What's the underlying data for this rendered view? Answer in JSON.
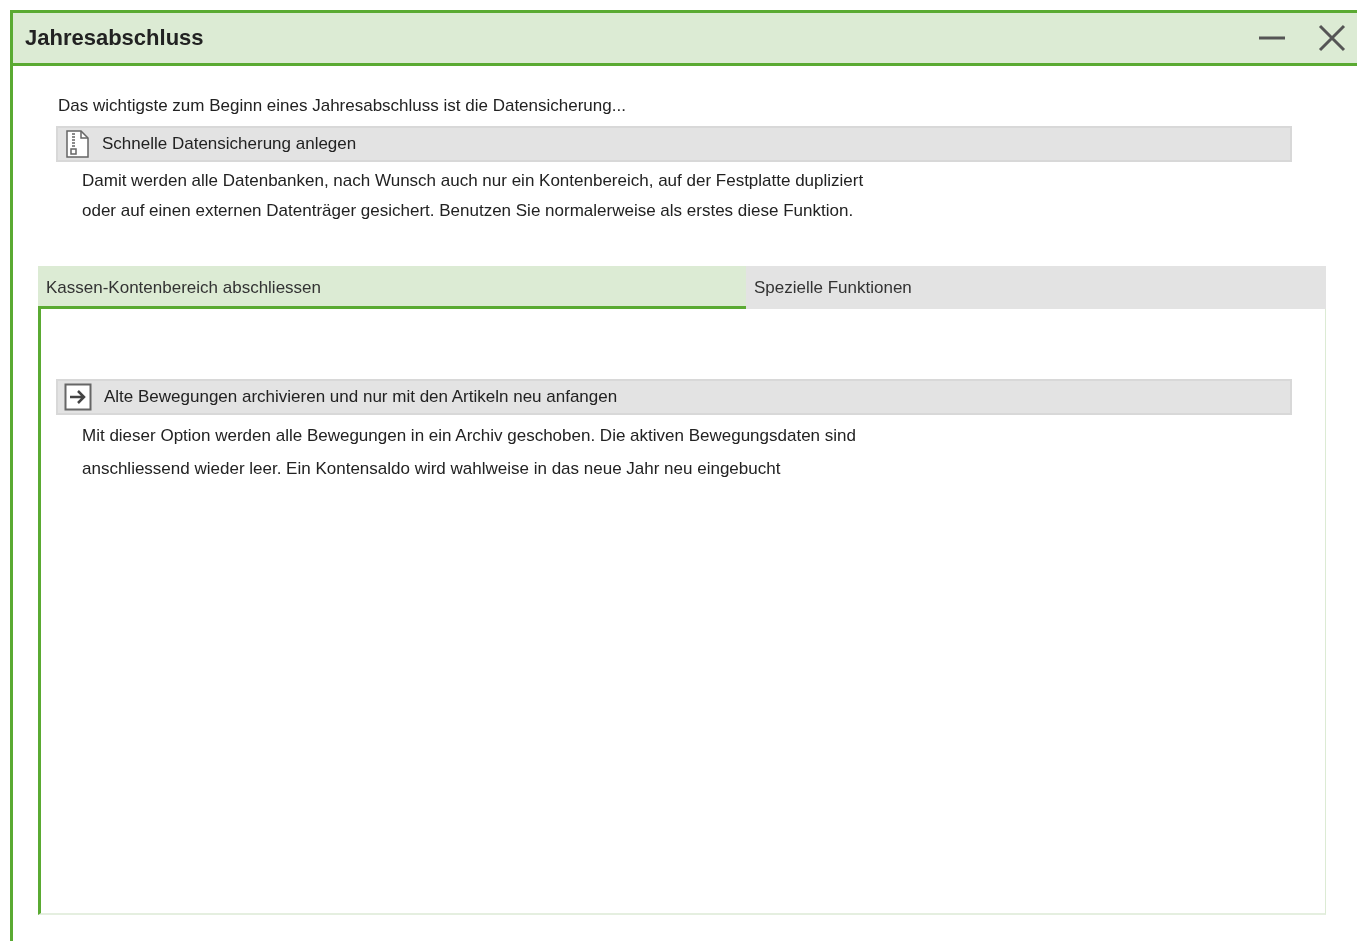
{
  "window": {
    "title": "Jahresabschluss"
  },
  "intro": "Das wichtigste zum Beginn eines Jahresabschluss ist die Datensicherung...",
  "backup": {
    "label": "Schnelle Datensicherung anlegen",
    "description_lines": [
      "Damit werden alle Datenbanken, nach Wunsch auch nur ein Kontenbereich, auf der Festplatte dupliziert",
      "oder auf einen externen Datenträger gesichert. Benutzen Sie normalerweise als erstes diese Funktion."
    ]
  },
  "tabs": [
    {
      "label": "Kassen-Kontenbereich abschliessen",
      "selected": true
    },
    {
      "label": "Spezielle Funktionen",
      "selected": false
    }
  ],
  "panel": {
    "action": {
      "label": "Alte Bewegungen archivieren und nur mit den Artikeln neu anfangen",
      "description_lines": [
        "Mit dieser Option werden alle Bewegungen in ein Archiv geschoben. Die aktiven Bewegungsdaten sind",
        "anschliessend wieder leer. Ein Kontensaldo wird wahlweise in das neue Jahr neu eingebucht"
      ]
    }
  }
}
